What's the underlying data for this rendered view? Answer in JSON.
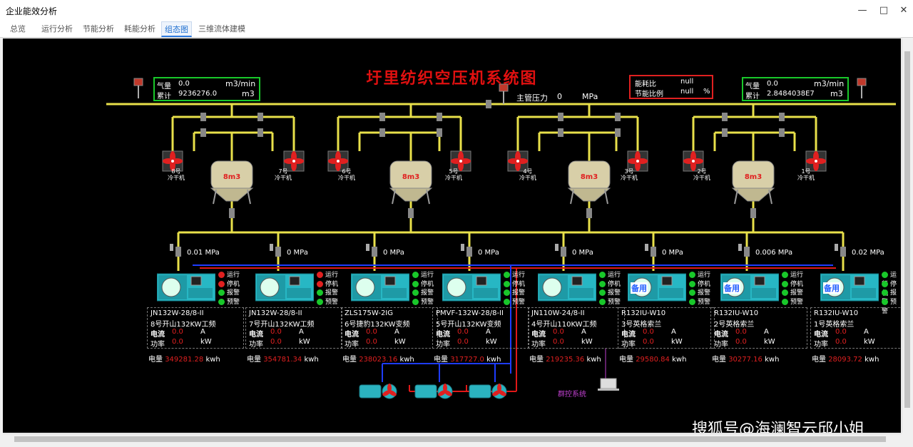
{
  "window": {
    "title": "企业能效分析"
  },
  "tabs": [
    {
      "label": "总览"
    },
    {
      "label": "运行分析"
    },
    {
      "label": "节能分析"
    },
    {
      "label": "耗能分析"
    },
    {
      "label": "组态图",
      "active": true
    },
    {
      "label": "三维流体建模"
    }
  ],
  "diagram": {
    "title": "圩里纺织空压机系统图",
    "flow_left": {
      "flow_label": "气量",
      "flow_value": "0.0",
      "flow_unit": "m3/min",
      "total_label": "累计",
      "total_value": "9236276.0",
      "total_unit": "m3"
    },
    "flow_right": {
      "flow_label": "气量",
      "flow_value": "0.0",
      "flow_unit": "m3/min",
      "total_label": "累计",
      "total_value": "2.8484038E7",
      "total_unit": "m3"
    },
    "ratio": {
      "consumption_label": "能耗比",
      "consumption_value": "null",
      "saving_label": "节能比例",
      "saving_value": "null",
      "saving_unit": "%"
    },
    "main_pressure": {
      "label": "主管压力",
      "value": "0",
      "unit": "MPa"
    },
    "tank_volume": "8m3",
    "dryers": [
      "8号\n冷干机",
      "7号\n冷干机",
      "6号\n冷干机",
      "5号\n冷干机",
      "4号\n冷干机",
      "3号\n冷干机",
      "2号\n冷干机",
      "1号\n冷干机"
    ],
    "status_labels": [
      "运行",
      "停机",
      "报警",
      "预警"
    ],
    "standby_label": "备用",
    "compressors": [
      {
        "pressure": "0.01",
        "pressure_unit": "MPa",
        "model": "JN132W-28/8-II",
        "desc": "8号开山132KW工频",
        "current_label": "电流",
        "current": "0.0",
        "current_unit": "A",
        "power_label": "功率",
        "power": "0.0",
        "power_unit": "kW",
        "energy_label": "电量",
        "energy": "349281.28",
        "energy_unit": "kwh",
        "state": "停机",
        "standby": false
      },
      {
        "pressure": "0",
        "pressure_unit": "MPa",
        "model": "JN132W-28/8-II",
        "desc": "7号开山132KW工频",
        "current_label": "电流",
        "current": "0.0",
        "current_unit": "A",
        "power_label": "功率",
        "power": "0.0",
        "power_unit": "kW",
        "energy_label": "电量",
        "energy": "354781.34",
        "energy_unit": "kwh",
        "state": "停机",
        "standby": false
      },
      {
        "pressure": "0",
        "pressure_unit": "MPa",
        "model": "ZLS175W-2IG",
        "desc": "6号捷豹132KW变频",
        "current_label": "电流",
        "current": "0.0",
        "current_unit": "A",
        "power_label": "功率",
        "power": "0.0",
        "power_unit": "kW",
        "energy_label": "电量",
        "energy": "238023.16",
        "energy_unit": "kwh",
        "state": "运行",
        "standby": false
      },
      {
        "pressure": "0",
        "pressure_unit": "MPa",
        "model": "PMVF-132W-28/8-II",
        "desc": "5号开山132KW变频",
        "current_label": "电流",
        "current": "0.0",
        "current_unit": "A",
        "power_label": "功率",
        "power": "0.0",
        "power_unit": "kW",
        "energy_label": "电量",
        "energy": "317727.0",
        "energy_unit": "kwh",
        "state": "运行",
        "standby": false
      },
      {
        "pressure": "0",
        "pressure_unit": "MPa",
        "model": "JN110W-24/8-II",
        "desc": "4号开山110KW工频",
        "current_label": "电流",
        "current": "0.0",
        "current_unit": "A",
        "power_label": "功率",
        "power": "0.0",
        "power_unit": "kW",
        "energy_label": "电量",
        "energy": "219235.36",
        "energy_unit": "kwh",
        "state": "运行",
        "standby": false
      },
      {
        "pressure": "0",
        "pressure_unit": "MPa",
        "model": "R132IU-W10",
        "desc": "3号英格索兰",
        "current_label": "电流",
        "current": "0.0",
        "current_unit": "A",
        "power_label": "功率",
        "power": "0.0",
        "power_unit": "kW",
        "energy_label": "电量",
        "energy": "29580.84",
        "energy_unit": "kwh",
        "state": "运行",
        "standby": true
      },
      {
        "pressure": "0.006",
        "pressure_unit": "MPa",
        "model": "R132IU-W10",
        "desc": "2号英格索兰",
        "current_label": "电流",
        "current": "0.0",
        "current_unit": "A",
        "power_label": "功率",
        "power": "0.0",
        "power_unit": "kW",
        "energy_label": "电量",
        "energy": "30277.16",
        "energy_unit": "kwh",
        "state": "运行",
        "standby": true
      },
      {
        "pressure": "0.02",
        "pressure_unit": "MPa",
        "model": "R132IU-W10",
        "desc": "1号英格索兰",
        "current_label": "电流",
        "current": "0.0",
        "current_unit": "A",
        "power_label": "功率",
        "power": "0.0",
        "power_unit": "kW",
        "energy_label": "电量",
        "energy": "28093.72",
        "energy_unit": "kwh",
        "state": "运行",
        "standby": true
      }
    ],
    "group_control_label": "群控系统",
    "watermark": "搜狐号@海澜智云邱小姐",
    "colors": {
      "pipe": "#e8e04a",
      "running": "#19c82a",
      "stopped": "#e02020",
      "water_blue": "#1e3cff",
      "water_red": "#e01818",
      "compressor": "#27b7c4"
    }
  }
}
